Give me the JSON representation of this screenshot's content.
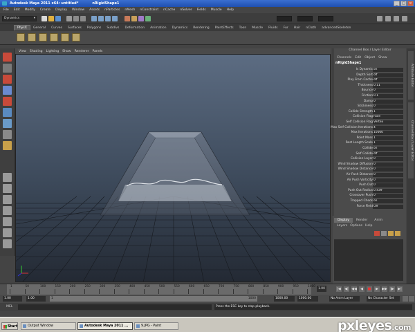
{
  "window": {
    "title": "Autodesk Maya 2011 x64: untitled*",
    "subtitle": "nRigidShape1",
    "controls": [
      "_",
      "□",
      "×"
    ]
  },
  "menubar": [
    "File",
    "Edit",
    "Modify",
    "Create",
    "Display",
    "Window",
    "Assets",
    "nParticles",
    "nMesh",
    "nConstraint",
    "nCache",
    "nSolver",
    "Fields",
    "Muscle",
    "Help"
  ],
  "statusline": {
    "mode": "Dynamics"
  },
  "shelf": {
    "tabs": [
      "PhysX",
      "General",
      "Curves",
      "Surfaces",
      "Polygons",
      "Subdivs",
      "Deformation",
      "Animation",
      "Dynamics",
      "Rendering",
      "PaintEffects",
      "Toon",
      "Muscle",
      "Fluids",
      "Fur",
      "Hair",
      "nCloth",
      "advancedSkeleton"
    ],
    "active_tab": "PhysX"
  },
  "viewport": {
    "menu": [
      "View",
      "Shading",
      "Lighting",
      "Show",
      "Renderer",
      "Panels"
    ]
  },
  "channel_box": {
    "header": "Channel Box / Layer Editor",
    "menu": [
      "Channels",
      "Edit",
      "Object",
      "Show"
    ],
    "node": "nRigidShape1",
    "attributes": [
      {
        "label": "Is Dynamic",
        "value": "on"
      },
      {
        "label": "Depth Sort",
        "value": "off"
      },
      {
        "label": "Play From Cache",
        "value": "off"
      },
      {
        "label": "Thickness",
        "value": "0.11"
      },
      {
        "label": "Bounce",
        "value": "0"
      },
      {
        "label": "Friction",
        "value": "0.1"
      },
      {
        "label": "Damp",
        "value": "0"
      },
      {
        "label": "Stickiness",
        "value": "0"
      },
      {
        "label": "Collide Strength",
        "value": "1"
      },
      {
        "label": "Collision Flag",
        "value": "Face"
      },
      {
        "label": "Self Collision Flag",
        "value": "Vertex"
      },
      {
        "label": "Max Self Collision Iterations",
        "value": "4"
      },
      {
        "label": "Max Iterations",
        "value": "10000"
      },
      {
        "label": "Point Mass",
        "value": "1"
      },
      {
        "label": "Rest Length Scale",
        "value": "1"
      },
      {
        "label": "Collide",
        "value": "on"
      },
      {
        "label": "Self Collide",
        "value": "off"
      },
      {
        "label": "Collision Layer",
        "value": "0"
      },
      {
        "label": "Wind Shadow Diffusion",
        "value": "0"
      },
      {
        "label": "Wind Shadow Distance",
        "value": "0"
      },
      {
        "label": "Air Push Distance",
        "value": "0"
      },
      {
        "label": "Air Push Vorticity",
        "value": "0"
      },
      {
        "label": "Push Out",
        "value": "0"
      },
      {
        "label": "Push Out Radius",
        "value": "0.439"
      },
      {
        "label": "Crossover Push",
        "value": "0"
      },
      {
        "label": "Trapped Check",
        "value": "on"
      },
      {
        "label": "Force Field",
        "value": "Off"
      }
    ]
  },
  "side_tabs": [
    "Attribute Editor",
    "Channel Box / Layer Editor"
  ],
  "layer_editor": {
    "tabs": [
      "Display",
      "Render",
      "Anim"
    ],
    "active_tab": "Display",
    "menu": [
      "Layers",
      "Options",
      "Help"
    ]
  },
  "timeline": {
    "ticks": [
      "1",
      "50",
      "100",
      "150",
      "200",
      "250",
      "300",
      "350",
      "400",
      "450",
      "500",
      "550",
      "600",
      "650",
      "700",
      "750",
      "800",
      "850",
      "900",
      "950",
      "1000"
    ],
    "current_frame": "1.00",
    "playback_buttons": [
      "|◀",
      "◀|",
      "◀◀",
      "◀",
      "■",
      "▶",
      "▶▶",
      "|▶",
      "▶|"
    ]
  },
  "range": {
    "start": "1.00",
    "playback_start": "1.00",
    "range_label": "1",
    "range_end_label": "1000",
    "playback_end": "1000.00",
    "end": "1000.00",
    "anim_layer": "No Anim Layer",
    "character_set": "No Character Set"
  },
  "command_line": {
    "label": "MEL",
    "help": "Press the ESC key to stop playback."
  },
  "taskbar": {
    "start": "Start",
    "tasks": [
      {
        "label": "Output Window",
        "active": false
      },
      {
        "label": "Autodesk Maya 2011 ...",
        "active": true
      },
      {
        "label": "9.JPG - Paint",
        "active": false
      }
    ]
  },
  "watermark": {
    "main": "pxleyes",
    "tld": ".com"
  }
}
